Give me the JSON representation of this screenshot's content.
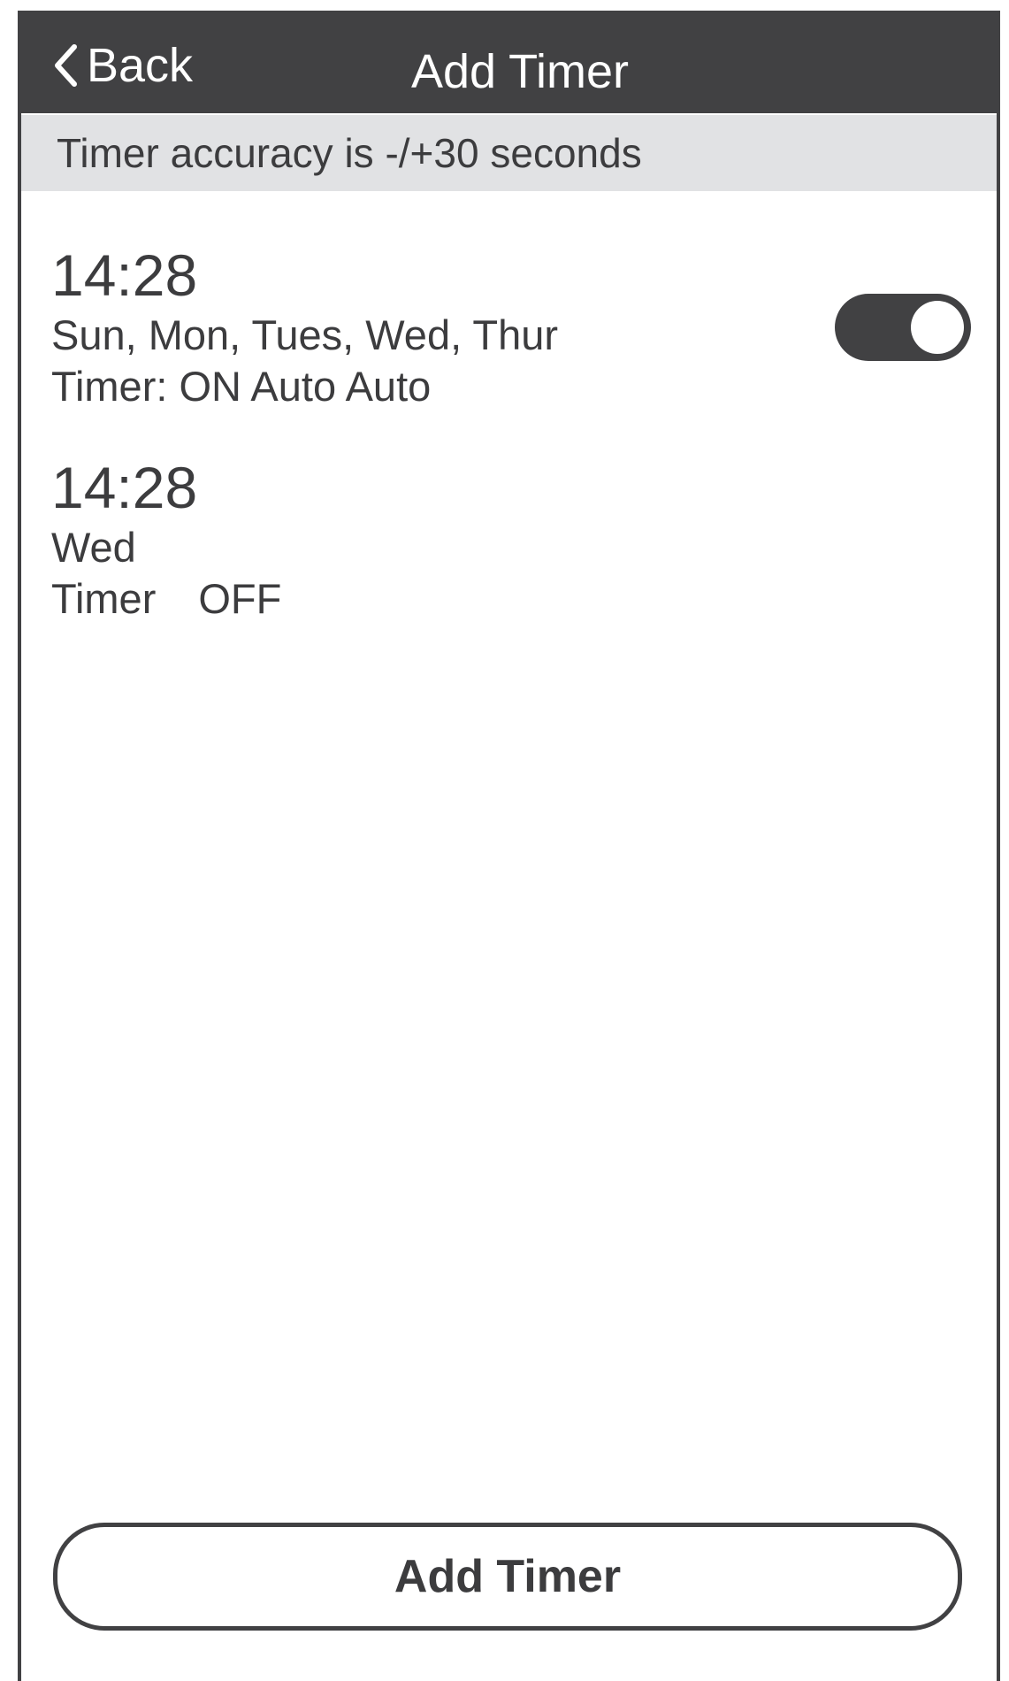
{
  "header": {
    "back_label": "Back",
    "title": "Add Timer"
  },
  "notice": {
    "text": "Timer accuracy is -/+30 seconds"
  },
  "timers": [
    {
      "time": "14:28",
      "days": "Sun, Mon, Tues, Wed, Thur",
      "mode": "Timer: ON Auto Auto",
      "toggle_on": true
    },
    {
      "time": "14:28",
      "days": "Wed",
      "mode_label": "Timer",
      "mode_value": "OFF"
    }
  ],
  "footer": {
    "add_button_label": "Add Timer"
  },
  "colors": {
    "header_bg": "#414143",
    "notice_bg": "#e1e2e4",
    "text": "#3c3c3e"
  },
  "icons": [
    "chevron-left-icon"
  ]
}
